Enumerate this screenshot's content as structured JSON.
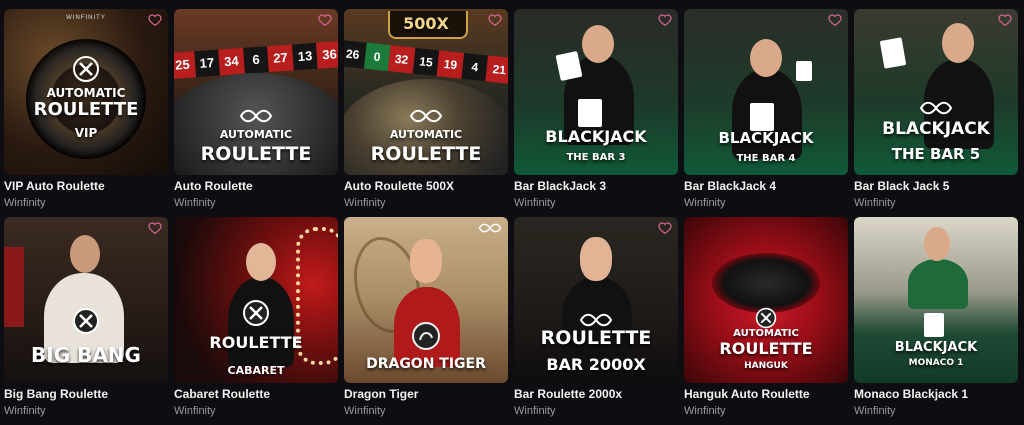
{
  "colors": {
    "background": "#0e0e12",
    "heart": "#e06a9a",
    "title": "#f2f2f2",
    "provider": "#9a9aa2"
  },
  "games": [
    {
      "title": "VIP Auto Roulette",
      "provider": "Winfinity",
      "overlay": [
        "AUTOMATIC",
        "ROULETTE",
        "VIP"
      ],
      "brand": "WINFINITY"
    },
    {
      "title": "Auto Roulette",
      "provider": "Winfinity",
      "overlay": [
        "AUTOMATIC",
        "ROULETTE"
      ],
      "numbers": [
        "25",
        "17",
        "34",
        "6",
        "27",
        "13",
        "36"
      ]
    },
    {
      "title": "Auto Roulette 500X",
      "provider": "Winfinity",
      "overlay": [
        "500X",
        "AUTOMATIC",
        "ROULETTE"
      ],
      "numbers": [
        "26",
        "0",
        "32",
        "15",
        "19",
        "4",
        "21"
      ]
    },
    {
      "title": "Bar BlackJack 3",
      "provider": "Winfinity",
      "overlay": [
        "BLACKJACK",
        "THE BAR 3"
      ]
    },
    {
      "title": "Bar BlackJack 4",
      "provider": "Winfinity",
      "overlay": [
        "BLACKJACK",
        "THE BAR 4"
      ]
    },
    {
      "title": "Bar Black Jack 5",
      "provider": "Winfinity",
      "overlay": [
        "BLACKJACK",
        "THE BAR 5"
      ]
    },
    {
      "title": "Big Bang Roulette",
      "provider": "Winfinity",
      "overlay": [
        "BIG BANG"
      ]
    },
    {
      "title": "Cabaret Roulette",
      "provider": "Winfinity",
      "overlay": [
        "ROULETTE",
        "CABARET"
      ]
    },
    {
      "title": "Dragon Tiger",
      "provider": "Winfinity",
      "overlay": [
        "DRAGON TIGER"
      ]
    },
    {
      "title": "Bar Roulette 2000x",
      "provider": "Winfinity",
      "overlay": [
        "ROULETTE",
        "BAR 2000X"
      ]
    },
    {
      "title": "Hanguk Auto Roulette",
      "provider": "Winfinity",
      "overlay": [
        "AUTOMATIC",
        "ROULETTE",
        "HANGUK"
      ]
    },
    {
      "title": "Monaco Blackjack 1",
      "provider": "Winfinity",
      "overlay": [
        "BLACKJACK",
        "MONACO 1"
      ]
    }
  ]
}
